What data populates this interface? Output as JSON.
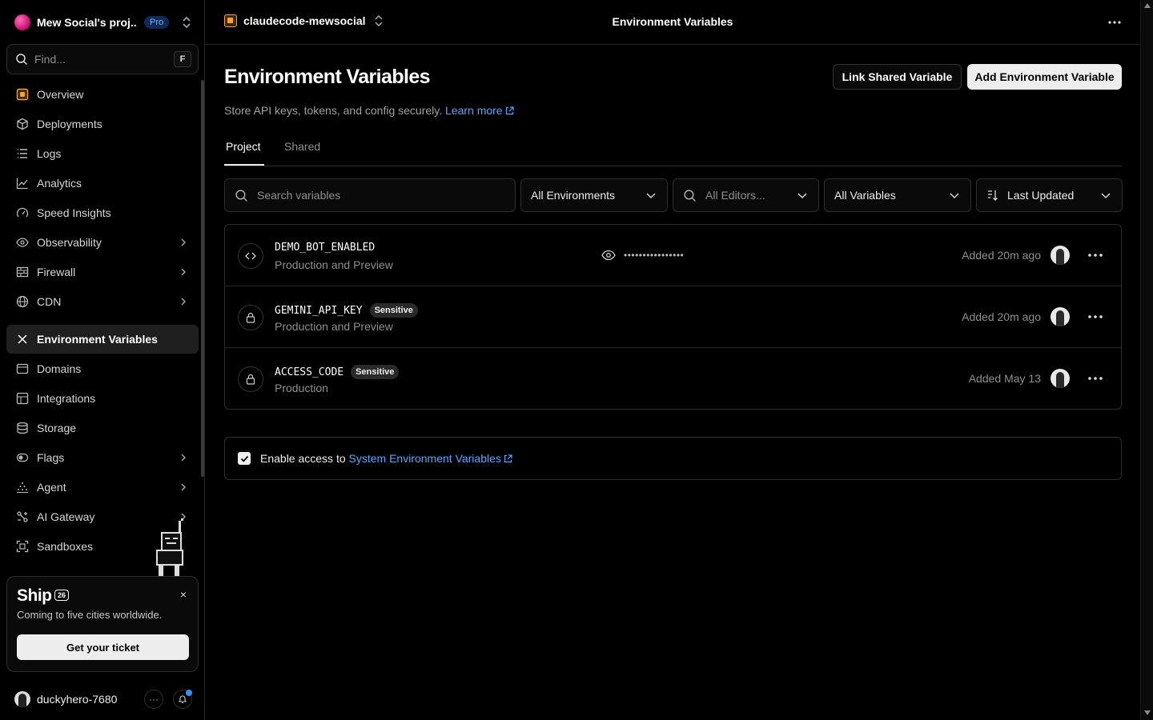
{
  "sidebar": {
    "team_name": "Mew Social's proj...",
    "plan": "Pro",
    "find_placeholder": "Find...",
    "find_shortcut": "F",
    "items": [
      {
        "label": "Overview",
        "icon": "overview-icon"
      },
      {
        "label": "Deployments",
        "icon": "deployments-icon"
      },
      {
        "label": "Logs",
        "icon": "logs-icon"
      },
      {
        "label": "Analytics",
        "icon": "analytics-icon"
      },
      {
        "label": "Speed Insights",
        "icon": "speed-insights-icon"
      },
      {
        "label": "Observability",
        "icon": "observability-icon"
      },
      {
        "label": "Firewall",
        "icon": "firewall-icon"
      },
      {
        "label": "CDN",
        "icon": "globe-icon"
      },
      {
        "label": "Environment Variables",
        "icon": "env-vars-icon",
        "active": true
      },
      {
        "label": "Domains",
        "icon": "domains-icon"
      },
      {
        "label": "Integrations",
        "icon": "integrations-icon"
      },
      {
        "label": "Storage",
        "icon": "storage-icon"
      },
      {
        "label": "Flags",
        "icon": "flags-icon"
      },
      {
        "label": "Agent",
        "icon": "agent-icon"
      },
      {
        "label": "AI Gateway",
        "icon": "ai-gateway-icon"
      },
      {
        "label": "Sandboxes",
        "icon": "sandboxes-icon"
      }
    ],
    "promo": {
      "title": "Ship",
      "badge": "26",
      "subtitle": "Coming to five cities worldwide.",
      "button": "Get your ticket",
      "close": "×"
    },
    "user": {
      "name": "duckyhero-7680",
      "more": "···"
    }
  },
  "topbar": {
    "project": "claudecode-mewsocial",
    "title": "Environment Variables"
  },
  "main": {
    "title": "Environment Variables",
    "link_shared_button": "Link Shared Variable",
    "add_button": "Add Environment Variable",
    "subtitle": "Store API keys, tokens, and config securely.",
    "learn_more": "Learn more",
    "tabs": [
      {
        "label": "Project",
        "active": true
      },
      {
        "label": "Shared",
        "active": false
      }
    ],
    "filters": {
      "search_placeholder": "Search variables",
      "environments": "All Environments",
      "editors_placeholder": "All Editors...",
      "variables": "All Variables",
      "sort": "Last Updated"
    },
    "variables": [
      {
        "name": "DEMO_BOT_ENABLED",
        "env": "Production and Preview",
        "sensitive": false,
        "value": "••••••••••••••••",
        "date": "Added 20m ago",
        "icon": "code-icon"
      },
      {
        "name": "GEMINI_API_KEY",
        "env": "Production and Preview",
        "sensitive": true,
        "sensitive_label": "Sensitive",
        "date": "Added 20m ago",
        "icon": "lock-icon"
      },
      {
        "name": "ACCESS_CODE",
        "env": "Production",
        "sensitive": true,
        "sensitive_label": "Sensitive",
        "date": "Added May 13",
        "icon": "lock-icon"
      }
    ],
    "system_vars": {
      "prefix": "Enable access to",
      "link": "System Environment Variables",
      "checked": true
    }
  },
  "colors": {
    "background": "#000000",
    "accent_link": "#52a8ff",
    "plan_badge": "#0f2a55",
    "brand_pink": "#d0157a",
    "project_icon": "#f5a524"
  }
}
